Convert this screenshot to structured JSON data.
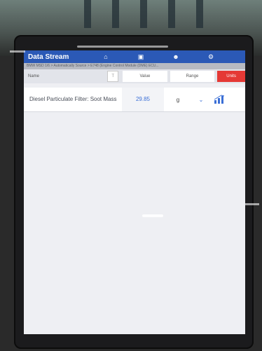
{
  "titlebar": {
    "title": "Data Stream",
    "icons": [
      "home-icon",
      "print-icon",
      "user-icon",
      "settings-icon"
    ]
  },
  "breadcrumb": "BMW MSD 1/6 > Automatically Source > E748 (Engine Control Module (DME) ECU...",
  "table": {
    "header": {
      "name": "Name",
      "value": "Value",
      "range": "Range",
      "unit": "Units"
    },
    "rows": [
      {
        "name": "Diesel Particulate Filter: Soot Mass",
        "value": "29.85",
        "unit": "g"
      }
    ]
  }
}
